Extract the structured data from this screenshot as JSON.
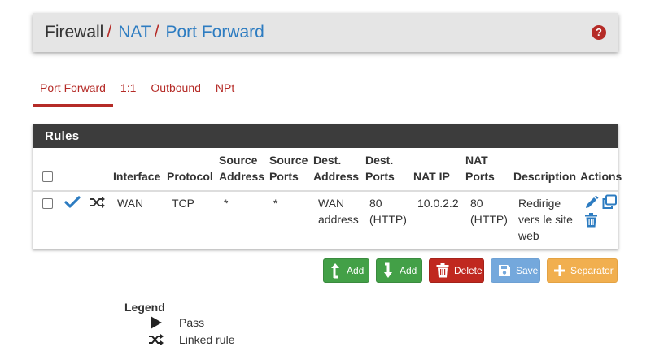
{
  "breadcrumb": {
    "items": [
      "Firewall",
      "NAT",
      "Port Forward"
    ],
    "separator": "/"
  },
  "tabs": [
    {
      "label": "Port Forward",
      "active": true
    },
    {
      "label": "1:1",
      "active": false
    },
    {
      "label": "Outbound",
      "active": false
    },
    {
      "label": "NPt",
      "active": false
    }
  ],
  "panel": {
    "title": "Rules",
    "columns": {
      "interface": "Interface",
      "protocol": "Protocol",
      "source_address": [
        "Source",
        "Address"
      ],
      "source_ports": [
        "Source",
        "Ports"
      ],
      "dest_address": [
        "Dest.",
        "Address"
      ],
      "dest_ports": [
        "Dest.",
        "Ports"
      ],
      "nat_ip": "NAT IP",
      "nat_ports": [
        "NAT",
        "Ports"
      ],
      "description": "Description",
      "actions": "Actions"
    },
    "rows": [
      {
        "interface": "WAN",
        "protocol": "TCP",
        "source_address": "*",
        "source_ports": "*",
        "dest_address": [
          "WAN",
          "address"
        ],
        "dest_ports": [
          "80",
          "(HTTP)"
        ],
        "nat_ip": "10.0.2.2",
        "nat_ports": [
          "80",
          "(HTTP)"
        ],
        "description": [
          "Redirige",
          "vers le site",
          "web"
        ]
      }
    ]
  },
  "buttons": {
    "add_top": "Add",
    "add_bottom": "Add",
    "delete": "Delete",
    "save": "Save",
    "separator": "Separator"
  },
  "legend": {
    "title": "Legend",
    "items": [
      "Pass",
      "Linked rule"
    ]
  },
  "colors": {
    "accent_red": "#b52b27",
    "link_blue": "#2d7cc1",
    "panel_header": "#3c3c3c",
    "success_green": "#43a047",
    "danger_red": "#c0281f",
    "info_blue": "#5c9ad6",
    "warning_orange": "#f0a73c"
  }
}
